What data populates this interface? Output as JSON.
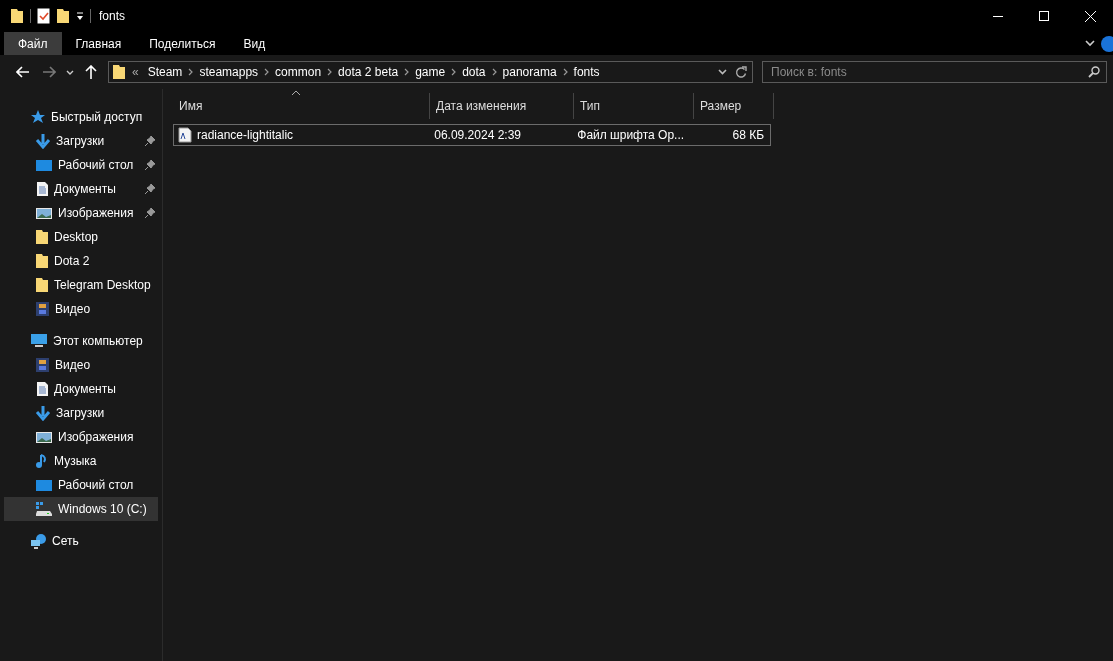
{
  "window": {
    "title": "fonts"
  },
  "ribbon_tabs": [
    {
      "label": "Файл",
      "selected": true
    },
    {
      "label": "Главная",
      "selected": false
    },
    {
      "label": "Поделиться",
      "selected": false
    },
    {
      "label": "Вид",
      "selected": false
    }
  ],
  "address_bar": {
    "overflow": "«",
    "crumbs": [
      "Steam",
      "steamapps",
      "common",
      "dota 2 beta",
      "game",
      "dota",
      "panorama",
      "fonts"
    ]
  },
  "search": {
    "placeholder": "Поиск в: fonts"
  },
  "sidebar": {
    "items": [
      {
        "label": "Быстрый доступ",
        "kind": "star",
        "selected": false,
        "children": [
          {
            "label": "Загрузки",
            "kind": "downloads",
            "pinned": true,
            "selected": false
          },
          {
            "label": "Рабочий стол",
            "kind": "desktop",
            "pinned": true,
            "selected": false
          },
          {
            "label": "Документы",
            "kind": "documents",
            "pinned": true,
            "selected": false
          },
          {
            "label": "Изображения",
            "kind": "pictures",
            "pinned": true,
            "selected": false
          },
          {
            "label": "Desktop",
            "kind": "folder",
            "pinned": false,
            "selected": false
          },
          {
            "label": "Dota 2",
            "kind": "folder",
            "pinned": false,
            "selected": false
          },
          {
            "label": "Telegram Desktop",
            "kind": "folder",
            "pinned": false,
            "selected": false
          },
          {
            "label": "Видео",
            "kind": "videos",
            "pinned": false,
            "selected": false
          }
        ]
      },
      {
        "label": "Этот компьютер",
        "kind": "computer",
        "selected": false,
        "children": [
          {
            "label": "Видео",
            "kind": "videos",
            "pinned": false,
            "selected": false
          },
          {
            "label": "Документы",
            "kind": "documents",
            "pinned": false,
            "selected": false
          },
          {
            "label": "Загрузки",
            "kind": "downloads",
            "pinned": false,
            "selected": false
          },
          {
            "label": "Изображения",
            "kind": "pictures",
            "pinned": false,
            "selected": false
          },
          {
            "label": "Музыка",
            "kind": "music",
            "pinned": false,
            "selected": false
          },
          {
            "label": "Рабочий стол",
            "kind": "desktop",
            "pinned": false,
            "selected": false
          },
          {
            "label": "Windows 10 (C:)",
            "kind": "drive",
            "pinned": false,
            "selected": true
          }
        ]
      },
      {
        "label": "Сеть",
        "kind": "network",
        "selected": false
      }
    ]
  },
  "file_list": {
    "columns": [
      {
        "label": "Имя",
        "sorted": true
      },
      {
        "label": "Дата изменения"
      },
      {
        "label": "Тип"
      },
      {
        "label": "Размер"
      }
    ],
    "rows": [
      {
        "name": "radiance-lightitalic",
        "date": "06.09.2024 2:39",
        "type": "Файл шрифта Op...",
        "size": "68 КБ",
        "focused": true,
        "selected": false
      }
    ]
  }
}
